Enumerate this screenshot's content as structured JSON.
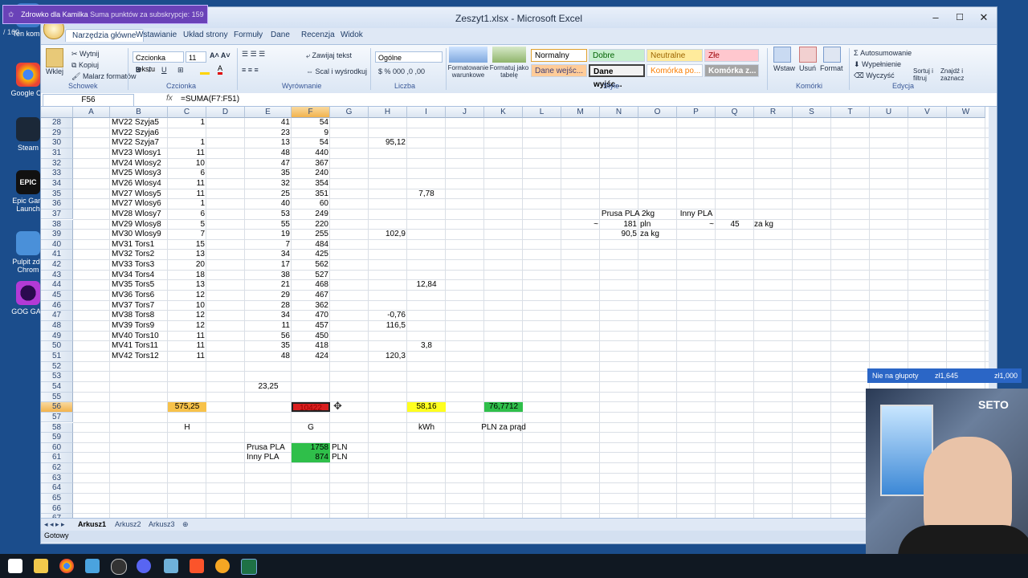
{
  "desktop_icons": [
    "Ten komp",
    "Google Ch",
    "Steam",
    "Epic Gam Launch",
    "Pulpit zda Chrom",
    "GOG GAL"
  ],
  "subscription_popup": {
    "name": "Zdrowko dla Kamilka",
    "text": "Suma punktów za subskrypcje: 159 / 160"
  },
  "window": {
    "title": "Zeszyt1.xlsx - Microsoft Excel",
    "minimize": "–",
    "maximize": "☐",
    "close": "✕"
  },
  "tabs": [
    "Narzędzia główne",
    "Wstawianie",
    "Układ strony",
    "Formuły",
    "Dane",
    "Recenzja",
    "Widok"
  ],
  "ribbon": {
    "clipboard": {
      "paste": "Wklej",
      "cut": "Wytnij",
      "copy": "Kopiuj",
      "painter": "Malarz formatów",
      "label": "Schowek"
    },
    "font": {
      "name": "Czcionka tekstu",
      "size": "11",
      "label": "Czcionka"
    },
    "alignment": {
      "wrap": "Zawijaj tekst",
      "merge": "Scal i wyśrodkuj",
      "label": "Wyrównanie"
    },
    "number": {
      "format": "Ogólne",
      "label": "Liczba"
    },
    "styles": {
      "cond": "Formatowanie warunkowe",
      "table": "Formatuj jako tabelę",
      "normal": "Normalny",
      "good": "Dobre",
      "neutral": "Neutralne",
      "bad": "Złe",
      "input": "Dane wejśc...",
      "output": "Dane wyjśc...",
      "cell": "Komórka po...",
      "cell2": "Komórka z...",
      "label": "Style"
    },
    "cells": {
      "insert": "Wstaw",
      "delete": "Usuń",
      "format": "Format",
      "label": "Komórki"
    },
    "editing": {
      "autosum": "Autosumowanie",
      "fill": "Wypełnienie",
      "clear": "Wyczyść",
      "sort": "Sortuj i filtruj",
      "find": "Znajdź i zaznacz",
      "label": "Edycja"
    }
  },
  "formula_bar": {
    "name_box": "F56",
    "fx": "fx",
    "formula": "=SUMA(F7:F51)"
  },
  "columns": [
    "A",
    "B",
    "C",
    "D",
    "E",
    "F",
    "G",
    "H",
    "I",
    "J",
    "K",
    "L",
    "M",
    "N",
    "O",
    "P",
    "Q",
    "R",
    "S",
    "T",
    "U",
    "V",
    "W"
  ],
  "rows": [
    "28",
    "29",
    "30",
    "31",
    "32",
    "33",
    "34",
    "35",
    "36",
    "37",
    "38",
    "39",
    "40",
    "41",
    "42",
    "43",
    "44",
    "45",
    "46",
    "47",
    "48",
    "49",
    "50",
    "51",
    "52",
    "53",
    "54",
    "55",
    "56",
    "57",
    "58",
    "59",
    "60",
    "61",
    "62",
    "63",
    "64",
    "65",
    "66",
    "67"
  ],
  "data_rows": [
    {
      "b": "MV22 Szyja5",
      "c": "1",
      "e": "41",
      "f": "54",
      "h": "",
      "i": ""
    },
    {
      "b": "MV22 Szyja6",
      "c": "",
      "e": "23",
      "f": "9",
      "h": "",
      "i": ""
    },
    {
      "b": "MV22 Szyja7",
      "c": "1",
      "e": "13",
      "f": "54",
      "h": "95,12",
      "i": ""
    },
    {
      "b": "MV23 Wlosy1",
      "c": "11",
      "e": "48",
      "f": "440",
      "h": "",
      "i": ""
    },
    {
      "b": "MV24 Wlosy2",
      "c": "10",
      "e": "47",
      "f": "367",
      "h": "",
      "i": ""
    },
    {
      "b": "MV25 Wlosy3",
      "c": "6",
      "e": "35",
      "f": "240",
      "h": "",
      "i": ""
    },
    {
      "b": "MV26 Wlosy4",
      "c": "11",
      "e": "32",
      "f": "354",
      "h": "",
      "i": ""
    },
    {
      "b": "MV27 Wlosy5",
      "c": "11",
      "e": "25",
      "f": "351",
      "h": "",
      "i": "7,78"
    },
    {
      "b": "MV27 Wlosy6",
      "c": "1",
      "e": "40",
      "f": "60",
      "h": "",
      "i": ""
    },
    {
      "b": "MV28 Wlosy7",
      "c": "6",
      "e": "53",
      "f": "249",
      "h": "",
      "i": ""
    },
    {
      "b": "MV29 Wlosy8",
      "c": "5",
      "e": "55",
      "f": "220",
      "h": "",
      "i": ""
    },
    {
      "b": "MV30 Wlosy9",
      "c": "7",
      "e": "19",
      "f": "255",
      "h": "102,9",
      "i": ""
    },
    {
      "b": "MV31 Tors1",
      "c": "15",
      "e": "7",
      "f": "484",
      "h": "",
      "i": ""
    },
    {
      "b": "MV32 Tors2",
      "c": "13",
      "e": "34",
      "f": "425",
      "h": "",
      "i": ""
    },
    {
      "b": "MV33 Tors3",
      "c": "20",
      "e": "17",
      "f": "562",
      "h": "",
      "i": ""
    },
    {
      "b": "MV34 Tors4",
      "c": "18",
      "e": "38",
      "f": "527",
      "h": "",
      "i": ""
    },
    {
      "b": "MV35 Tors5",
      "c": "13",
      "e": "21",
      "f": "468",
      "h": "",
      "i": "12,84"
    },
    {
      "b": "MV36 Tors6",
      "c": "12",
      "e": "29",
      "f": "467",
      "h": "",
      "i": ""
    },
    {
      "b": "MV37 Tors7",
      "c": "10",
      "e": "28",
      "f": "362",
      "h": "",
      "i": ""
    },
    {
      "b": "MV38 Tors8",
      "c": "12",
      "e": "34",
      "f": "470",
      "h": "-0,76",
      "i": ""
    },
    {
      "b": "MV39 Tors9",
      "c": "12",
      "e": "11",
      "f": "457",
      "h": "116,5",
      "i": ""
    },
    {
      "b": "MV40 Tors10",
      "c": "11",
      "e": "56",
      "f": "450",
      "h": "",
      "i": ""
    },
    {
      "b": "MV41 Tors11",
      "c": "11",
      "e": "35",
      "f": "418",
      "h": "",
      "i": "3,8"
    },
    {
      "b": "MV42 Tors12",
      "c": "11",
      "e": "48",
      "f": "424",
      "h": "120,3",
      "i": ""
    }
  ],
  "side_table": {
    "prusa": "Prusa PLA 2kg",
    "inny": "Inny PLA",
    "tilde1": "~",
    "price": "181",
    "pln": "pln",
    "tilde2": "~",
    "q45": "45",
    "zakg1": "za kg",
    "half": "90,5",
    "zakg2": "za kg"
  },
  "summary": {
    "e54": "23,25",
    "c56": "575,25",
    "f56": "10422",
    "i56": "58,16",
    "k56": "76,7712",
    "c58": "H",
    "f58": "G",
    "i58": "kWh",
    "k58": "PLN za prąd",
    "e60": "Prusa PLA",
    "f60": "1758",
    "g60": "PLN",
    "e61": "Inny PLA",
    "f61": "874",
    "g61": "PLN"
  },
  "sheet_tabs": [
    "Arkusz1",
    "Arkusz2",
    "Arkusz3"
  ],
  "status": "Gotowy",
  "ticker": {
    "label": "Nie na głupoty",
    "v1": "zł1,645",
    "v2": "zł1,000"
  },
  "webcam_sign": "SETO"
}
